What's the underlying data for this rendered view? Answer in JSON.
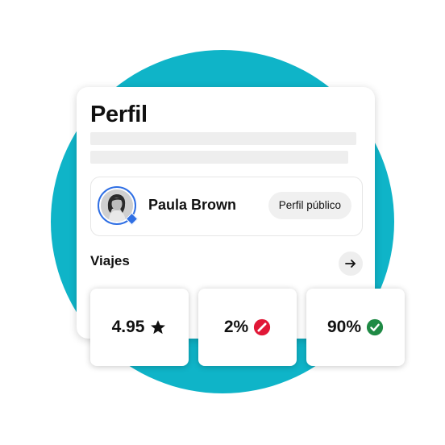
{
  "colors": {
    "background_circle": "#0fb4c8",
    "accent_blue": "#2f6fe4",
    "negative_red": "#e11837",
    "positive_green": "#1f8a45"
  },
  "profile": {
    "title": "Perfil",
    "name": "Paula Brown",
    "public_profile_label": "Perfil público"
  },
  "trips": {
    "label": "Viajes",
    "arrow_icon": "arrow-right-icon"
  },
  "stats": [
    {
      "value": "4.95",
      "icon": "star-icon"
    },
    {
      "value": "2%",
      "icon": "no-entry-red-icon"
    },
    {
      "value": "90%",
      "icon": "checkmark-green-icon"
    }
  ]
}
